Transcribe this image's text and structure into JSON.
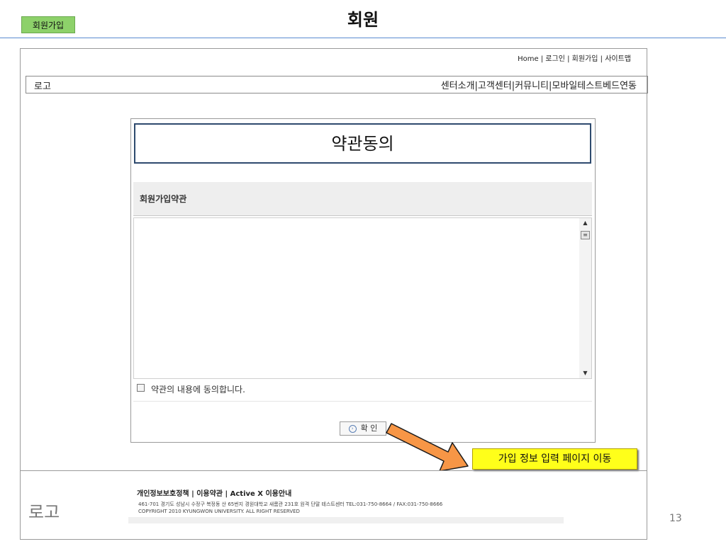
{
  "slide": {
    "tag": "회원가입",
    "title": "회원",
    "page_number": "13"
  },
  "site": {
    "top_links": "Home | 로그인 | 회원가입 | 사이트맵",
    "logo": "로고",
    "nav": [
      "센터소개",
      " | ",
      "고객센터",
      " | ",
      "커뮤니티",
      " | ",
      "모바일테스트베드연동"
    ]
  },
  "terms": {
    "title": "약관동의",
    "header_label": "회원가입약관",
    "agree_label": "약관의 내용에 동의합니다.",
    "confirm_label": "확 인",
    "checkbox_checked": false
  },
  "callout": {
    "text": "가입 정보 입력 페이지 이동",
    "color": "#ffff1a",
    "arrow_color": "#f79646"
  },
  "footer": {
    "logo": "로고",
    "links": "개인정보보호정책 | 이용약관 | Active X 이용안내",
    "address": "461-701 경기도 성남시 수정구 복정동 산 65번지 경원대학교 새롬관 231호 원격 단말 테스트센터 TEL:031-750-8664 / FAX:031-750-8666",
    "copyright": "COPYRIGHT 2010 KYUNGWON UNIVERSITY. ALL RIGHT RESERVED"
  }
}
